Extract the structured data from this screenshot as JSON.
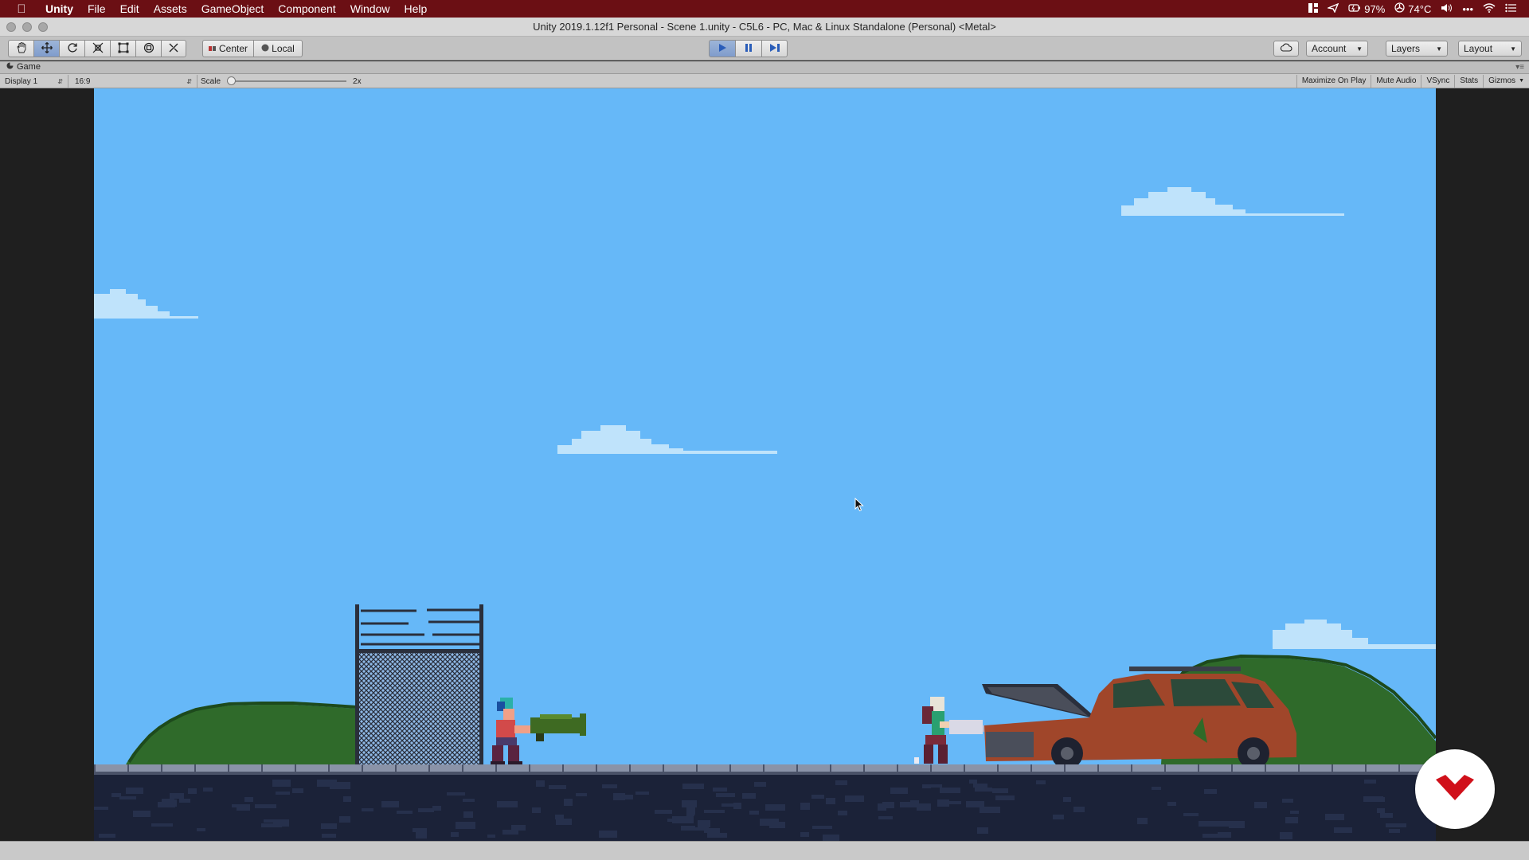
{
  "menubar": {
    "app": "Unity",
    "items": [
      "File",
      "Edit",
      "Assets",
      "GameObject",
      "Component",
      "Window",
      "Help"
    ],
    "battery": "97%",
    "temperature": "74°C",
    "icons": [
      "apple-icon",
      "layout-icon",
      "send-icon",
      "battery-icon",
      "fan-icon",
      "volume-icon",
      "more-icon",
      "wifi-icon",
      "notification-list-icon"
    ]
  },
  "window": {
    "title": "Unity 2019.1.12f1 Personal - Scene 1.unity - C5L6 - PC, Mac & Linux Standalone (Personal) <Metal>"
  },
  "toolbar": {
    "tools": [
      "hand-tool-icon",
      "move-tool-icon",
      "rotate-tool-icon",
      "scale-tool-icon",
      "rect-tool-icon",
      "transform-tool-icon",
      "custom-tool-icon"
    ],
    "pivot_label": "Center",
    "space_label": "Local",
    "account_label": "Account",
    "layers_label": "Layers",
    "layout_label": "Layout"
  },
  "game_tab": {
    "label": "Game"
  },
  "game_bar": {
    "display": "Display 1",
    "aspect": "16:9",
    "scale_label": "Scale",
    "scale_value": "2x",
    "scale_level": 0,
    "maximize_on_play": "Maximize On Play",
    "mute_audio": "Mute Audio",
    "vsync": "VSync",
    "stats": "Stats",
    "gizmos": "Gizmos"
  },
  "colors": {
    "menubar": "#6b0f14",
    "sky": "#66b8f8",
    "cloud": "#bfe3fb",
    "bush": "#2f6a2a",
    "ground": "#1b2238",
    "car": "#a0462a",
    "badge_logo": "#d0101a"
  }
}
